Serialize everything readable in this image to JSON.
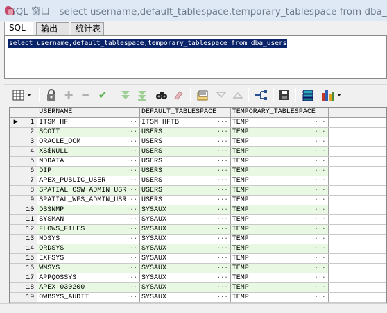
{
  "window": {
    "title": "SQL 窗口 - select username,default_tablespace,temporary_tablespace from dba_users"
  },
  "tabs": [
    {
      "label": "SQL"
    },
    {
      "label": "输出"
    },
    {
      "label": "统计表"
    }
  ],
  "editor": {
    "sql_text": "select username,default_tablespace,temporary_tablespace from dba_users"
  },
  "toolbar": {
    "icons": [
      "grid-layout-icon",
      "lock-icon",
      "add-row-icon",
      "delete-row-icon",
      "post-check-icon",
      "filter-down-icon",
      "filter-up-icon",
      "find-icon",
      "clear-icon",
      "query-by-example-icon",
      "next-page-icon",
      "last-page-icon",
      "export-icon",
      "save-icon",
      "import-icon",
      "chart-icon"
    ],
    "colors": {
      "green": "#55b24a",
      "disabled": "#b0b0b0"
    }
  },
  "grid": {
    "columns": [
      "USERNAME",
      "DEFAULT_TABLESPACE",
      "TEMPORARY_TABLESPACE"
    ],
    "current_row_marker": "▶",
    "row_colors": {
      "odd": "#ffffff",
      "even": "#e8f8e3"
    },
    "rows": [
      {
        "n": "1",
        "username": "ITSM_HF",
        "default_ts": "ITSM_HFTB",
        "temp_ts": "TEMP"
      },
      {
        "n": "2",
        "username": "SCOTT",
        "default_ts": "USERS",
        "temp_ts": "TEMP"
      },
      {
        "n": "3",
        "username": "ORACLE_OCM",
        "default_ts": "USERS",
        "temp_ts": "TEMP"
      },
      {
        "n": "4",
        "username": "XS$NULL",
        "default_ts": "USERS",
        "temp_ts": "TEMP"
      },
      {
        "n": "5",
        "username": "MDDATA",
        "default_ts": "USERS",
        "temp_ts": "TEMP"
      },
      {
        "n": "6",
        "username": "DIP",
        "default_ts": "USERS",
        "temp_ts": "TEMP"
      },
      {
        "n": "7",
        "username": "APEX_PUBLIC_USER",
        "default_ts": "USERS",
        "temp_ts": "TEMP"
      },
      {
        "n": "8",
        "username": "SPATIAL_CSW_ADMIN_USR",
        "default_ts": "USERS",
        "temp_ts": "TEMP"
      },
      {
        "n": "9",
        "username": "SPATIAL_WFS_ADMIN_USR",
        "default_ts": "USERS",
        "temp_ts": "TEMP"
      },
      {
        "n": "10",
        "username": "DBSNMP",
        "default_ts": "SYSAUX",
        "temp_ts": "TEMP"
      },
      {
        "n": "11",
        "username": "SYSMAN",
        "default_ts": "SYSAUX",
        "temp_ts": "TEMP"
      },
      {
        "n": "12",
        "username": "FLOWS_FILES",
        "default_ts": "SYSAUX",
        "temp_ts": "TEMP"
      },
      {
        "n": "13",
        "username": "MDSYS",
        "default_ts": "SYSAUX",
        "temp_ts": "TEMP"
      },
      {
        "n": "14",
        "username": "ORDSYS",
        "default_ts": "SYSAUX",
        "temp_ts": "TEMP"
      },
      {
        "n": "15",
        "username": "EXFSYS",
        "default_ts": "SYSAUX",
        "temp_ts": "TEMP"
      },
      {
        "n": "16",
        "username": "WMSYS",
        "default_ts": "SYSAUX",
        "temp_ts": "TEMP"
      },
      {
        "n": "17",
        "username": "APPQOSSYS",
        "default_ts": "SYSAUX",
        "temp_ts": "TEMP"
      },
      {
        "n": "18",
        "username": "APEX_030200",
        "default_ts": "SYSAUX",
        "temp_ts": "TEMP"
      },
      {
        "n": "19",
        "username": "OWBSYS_AUDIT",
        "default_ts": "SYSAUX",
        "temp_ts": "TEMP"
      }
    ]
  }
}
